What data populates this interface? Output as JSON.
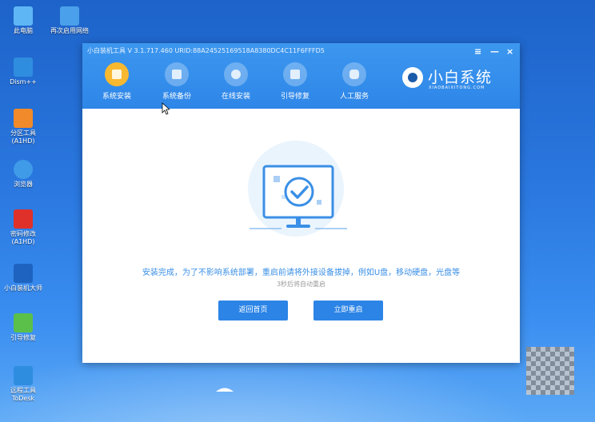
{
  "desktop": [
    {
      "label": "此电脑",
      "color": "#5fb6f5"
    },
    {
      "label": "再次启用网络",
      "color": "#4aa0ea"
    },
    {
      "label": "Dism++",
      "color": "#2f8de0"
    },
    {
      "label": "分区工具",
      "label2": "(A1HD)",
      "color": "#f08a2a"
    },
    {
      "label": "浏览器",
      "color": "#3f9ae8"
    },
    {
      "label": "密码修改",
      "label2": "(A1HD)",
      "color": "#e0302a"
    },
    {
      "label": "小白装机大师",
      "color": "#1e63c0"
    },
    {
      "label": "引导修复",
      "color": "#5ac04a"
    },
    {
      "label": "远程工具",
      "label2": "ToDesk",
      "color": "#2f8de0"
    }
  ],
  "window": {
    "title": "小白装机工具 V 3.1.717.460 URID:88A24525169518A8380DC4C11F6FFFD5",
    "menu": "≡",
    "minimize": "—",
    "close": "×"
  },
  "nav": [
    {
      "label": "系统安装",
      "active": true
    },
    {
      "label": "系统备份",
      "active": false
    },
    {
      "label": "在线安装",
      "active": false
    },
    {
      "label": "引导修复",
      "active": false
    },
    {
      "label": "人工服务",
      "active": false
    }
  ],
  "brand": {
    "name": "小白系统",
    "sub": "XIAOBAIXITONG.COM"
  },
  "main": {
    "message": "安装完成，为了不影响系统部署，重启前请将外接设备拔掉，例如U盘，移动硬盘，光盘等",
    "countdown": "3秒后将自动重启",
    "home_button": "返回首页",
    "restart_button": "立即重启"
  },
  "colors": {
    "accent": "#2b84e6",
    "message": "#3a8fe6",
    "countdown": "#9a9a9a"
  }
}
